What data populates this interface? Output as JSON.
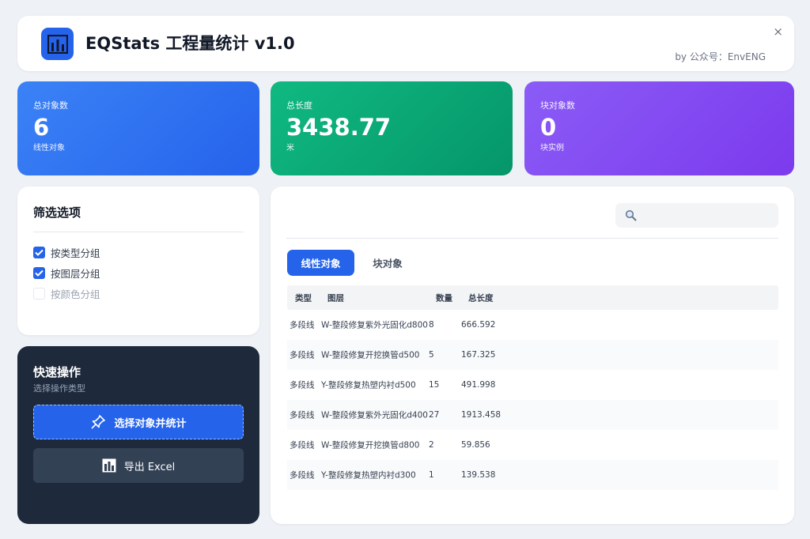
{
  "header": {
    "title": "EQStats 工程量统计 v1.0",
    "author": "by 公众号：EnvENG",
    "close_symbol": "×"
  },
  "stats": [
    {
      "label": "总对象数",
      "value": "6",
      "unit": "线性对象"
    },
    {
      "label": "总长度",
      "value": "3438.77",
      "unit": "米"
    },
    {
      "label": "块对象数",
      "value": "0",
      "unit": "块实例"
    }
  ],
  "filter": {
    "title": "筛选选项",
    "options": [
      {
        "label": "按类型分组",
        "checked": true
      },
      {
        "label": "按图层分组",
        "checked": true
      },
      {
        "label": "按颜色分组",
        "checked": false
      }
    ]
  },
  "quick": {
    "title": "快速操作",
    "subtitle": "选择操作类型",
    "select_label": "选择对象并统计",
    "export_label": "导出 Excel"
  },
  "search": {
    "placeholder": ""
  },
  "tabs": {
    "linear": "线性对象",
    "block": "块对象",
    "active": "linear"
  },
  "table": {
    "headers": [
      "类型",
      "图层",
      "数量",
      "总长度"
    ],
    "rows": [
      [
        "多段线",
        "W-整段修复紫外光固化d800",
        "8",
        "666.592"
      ],
      [
        "多段线",
        "W-整段修复开挖换管d500",
        "5",
        "167.325"
      ],
      [
        "多段线",
        "Y-整段修复热塑内衬d500",
        "15",
        "491.998"
      ],
      [
        "多段线",
        "W-整段修复紫外光固化d400",
        "27",
        "1913.458"
      ],
      [
        "多段线",
        "W-整段修复开挖换管d800",
        "2",
        "59.856"
      ],
      [
        "多段线",
        "Y-整段修复热塑内衬d300",
        "1",
        "139.538"
      ]
    ]
  },
  "colors": {
    "accent": "#2563eb",
    "green": "#059669",
    "purple": "#7c3aed",
    "dark_panel": "#1e293b"
  },
  "icons": {
    "logo": "bar-chart-icon",
    "close": "close-icon",
    "search": "search-icon",
    "select": "pin-icon",
    "export": "chart-export-icon",
    "check": "check-icon"
  }
}
